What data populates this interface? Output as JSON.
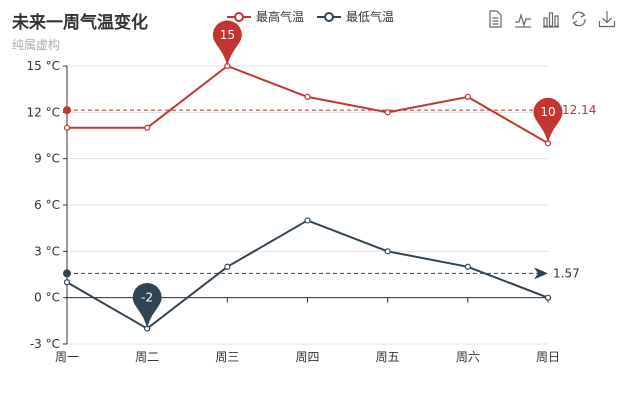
{
  "title": "未来一周气温变化",
  "subtitle": "纯属虚构",
  "toolbox": [
    "data-view-icon",
    "line-chart-icon",
    "bar-chart-icon",
    "restore-icon",
    "save-image-icon"
  ],
  "chart_data": {
    "type": "line",
    "categories": [
      "周一",
      "周二",
      "周三",
      "周四",
      "周五",
      "周六",
      "周日"
    ],
    "yTicks": [
      "-3 °C",
      "0 °C",
      "3 °C",
      "6 °C",
      "9 °C",
      "12 °C",
      "15 °C"
    ],
    "ylim": [
      -3,
      15
    ],
    "series": [
      {
        "name": "最高气温",
        "color": "#c23531",
        "values": [
          11,
          11,
          15,
          13,
          12,
          13,
          10
        ],
        "markPoints": [
          {
            "index": 2,
            "label": "15"
          },
          {
            "index": 6,
            "label": "10"
          }
        ],
        "average": 12.14,
        "averageLabel": "12.14"
      },
      {
        "name": "最低气温",
        "color": "#2f4554",
        "values": [
          1,
          -2,
          2,
          5,
          3,
          2,
          0
        ],
        "markPoints": [
          {
            "index": 1,
            "label": "-2"
          }
        ],
        "average": 1.57,
        "averageLabel": "1.57"
      }
    ]
  }
}
